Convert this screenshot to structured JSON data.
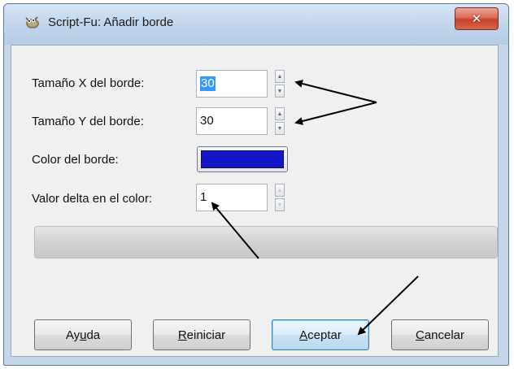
{
  "window": {
    "title": "Script-Fu: Añadir borde",
    "close_glyph": "✕",
    "app_icon": "gimp-wilber-icon"
  },
  "form": {
    "size_x": {
      "label": "Tamaño X del borde:",
      "value": "30"
    },
    "size_y": {
      "label": "Tamaño Y del borde:",
      "value": "30"
    },
    "color": {
      "label": "Color del borde:",
      "value": "#1515c8"
    },
    "delta": {
      "label": "Valor delta en el color:",
      "value": "1"
    }
  },
  "progress": {
    "fraction": 0
  },
  "buttons": {
    "help": {
      "before": "Ay",
      "mnemonic": "u",
      "after": "da"
    },
    "reset": {
      "before": "",
      "mnemonic": "R",
      "after": "einiciar"
    },
    "ok": {
      "before": "",
      "mnemonic": "A",
      "after": "ceptar"
    },
    "cancel": {
      "before": "",
      "mnemonic": "C",
      "after": "ancelar"
    }
  },
  "spinner_glyphs": {
    "up": "▲",
    "down": "▼"
  },
  "annotations": {
    "arrow_color": "#000000"
  }
}
